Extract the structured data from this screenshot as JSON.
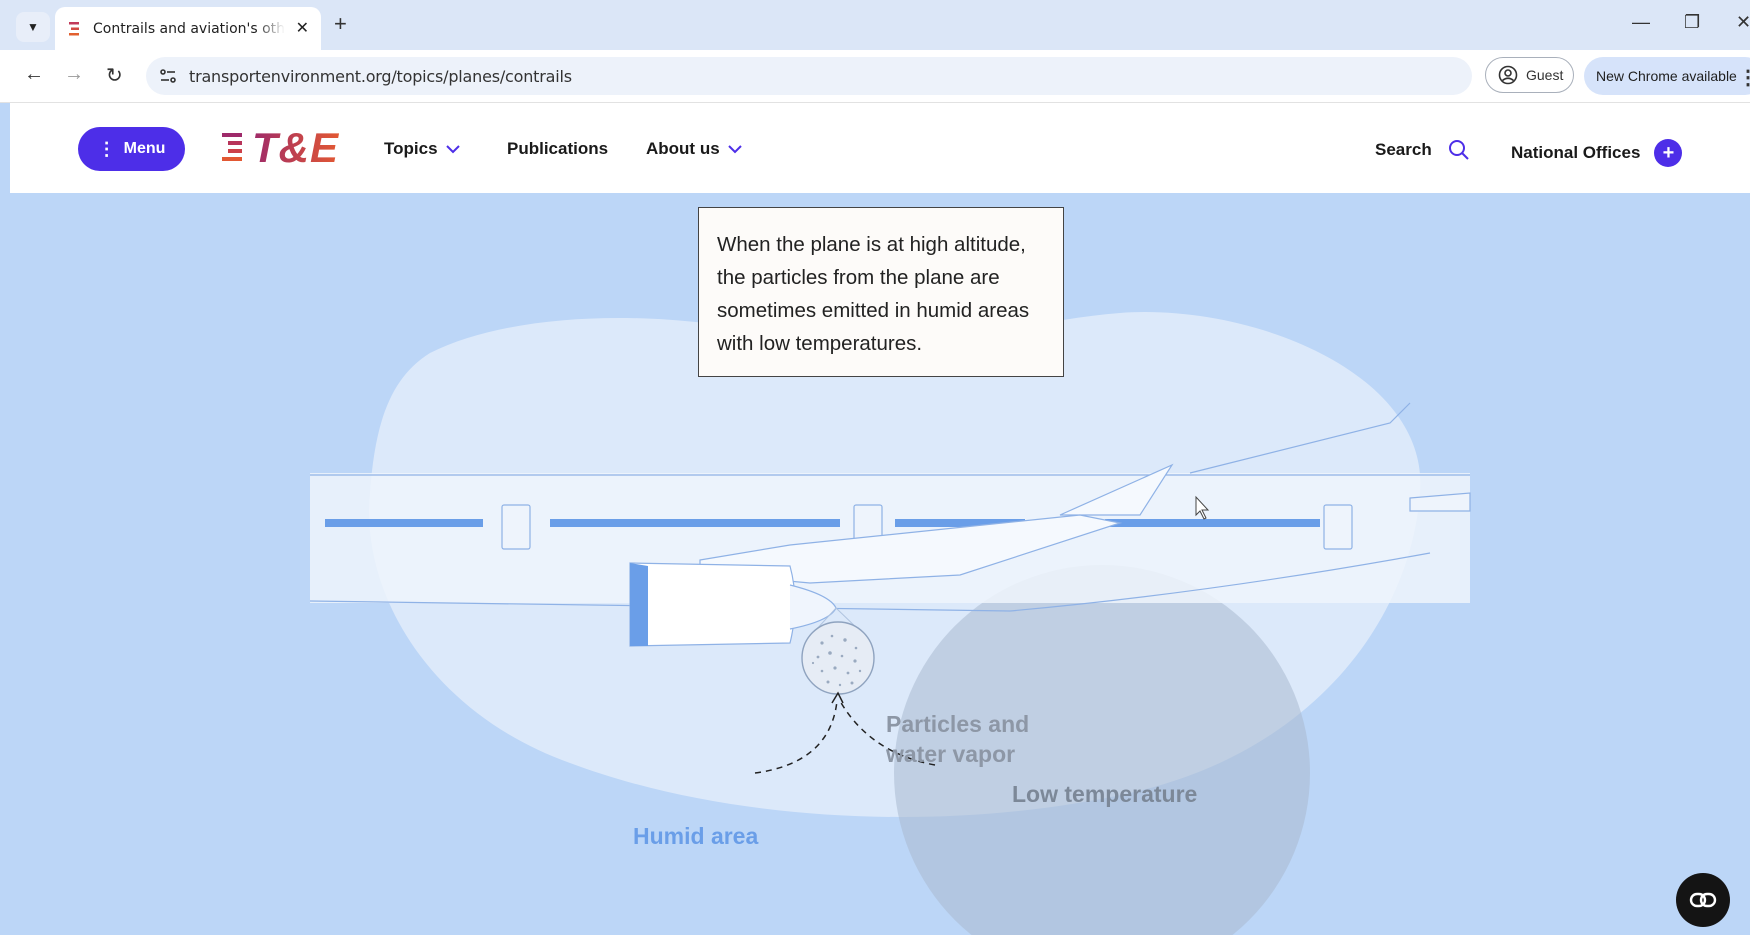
{
  "browser": {
    "tab_title": "Contrails and aviation's other h",
    "url": "transportenvironment.org/topics/planes/contrails",
    "guest_label": "Guest",
    "update_label": "New Chrome available",
    "icons": [
      "tab-list-icon",
      "favicon",
      "close-icon",
      "plus-icon",
      "minimize-icon",
      "restore-icon",
      "window-close-icon",
      "back-icon",
      "forward-icon",
      "reload-icon",
      "site-settings-icon",
      "profile-icon",
      "kebab-icon"
    ]
  },
  "site": {
    "menu_label": "Menu",
    "logo_text": "T&E",
    "nav": {
      "topics": "Topics",
      "publications": "Publications",
      "about": "About us"
    },
    "search_label": "Search",
    "offices_label": "National Offices",
    "brand_color": "#4d2ee8"
  },
  "content": {
    "callout": "When the plane is at high altitude, the particles from the plane are sometimes emitted in humid areas with low temperatures.",
    "particles_label_1": "Particles and",
    "particles_label_2": "water vapor",
    "low_temp_label": "Low temperature",
    "humid_label": "Humid area",
    "background_color": "#bcd6f7"
  }
}
